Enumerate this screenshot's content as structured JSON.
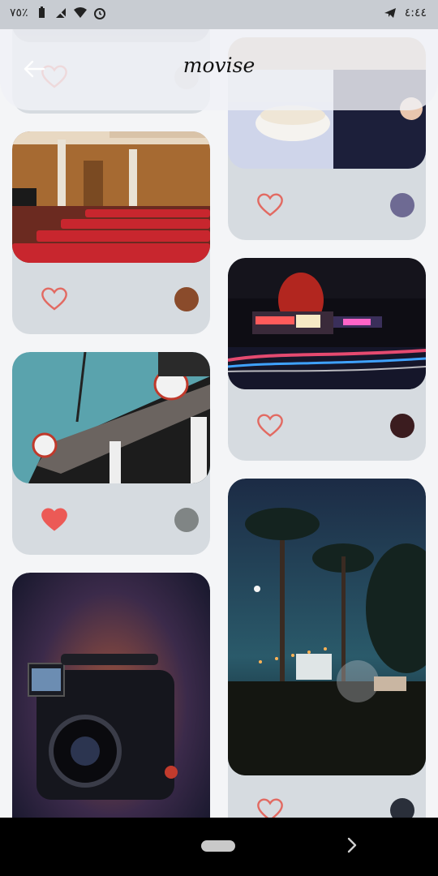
{
  "status_bar": {
    "battery_percent": "٧٥٪",
    "time": "٤:٤٤"
  },
  "app_bar": {
    "title": "movise"
  },
  "cards": [
    {
      "id": "card-top-left",
      "theme": "theater interior, light",
      "dot_color": "#c9c9c9",
      "liked": false
    },
    {
      "id": "card-popcorn",
      "theme": "popcorn in blanket",
      "dot_color": "#6e6a93",
      "liked": false
    },
    {
      "id": "card-red-seats",
      "theme": "cinema hall red seats",
      "dot_color": "#8a4b2b",
      "liked": false
    },
    {
      "id": "card-cinemas-night",
      "theme": "neon cinemas at night",
      "dot_color": "#3b1c1f",
      "liked": false
    },
    {
      "id": "card-movie-sign",
      "theme": "movie sign",
      "dot_color": "#808585",
      "liked": true
    },
    {
      "id": "card-palm-outdoor",
      "theme": "outdoor cinema under palms",
      "dot_color": "#2a2f3a",
      "liked": false
    },
    {
      "id": "card-camera",
      "theme": "cinema camera",
      "dot_color": "#1f2230",
      "liked": false
    }
  ],
  "colors": {
    "heart": "#e26a62",
    "heart_filled": "#ec5a56",
    "card_bg": "#d6dbe0",
    "app_bar": "#f0f2f6"
  }
}
